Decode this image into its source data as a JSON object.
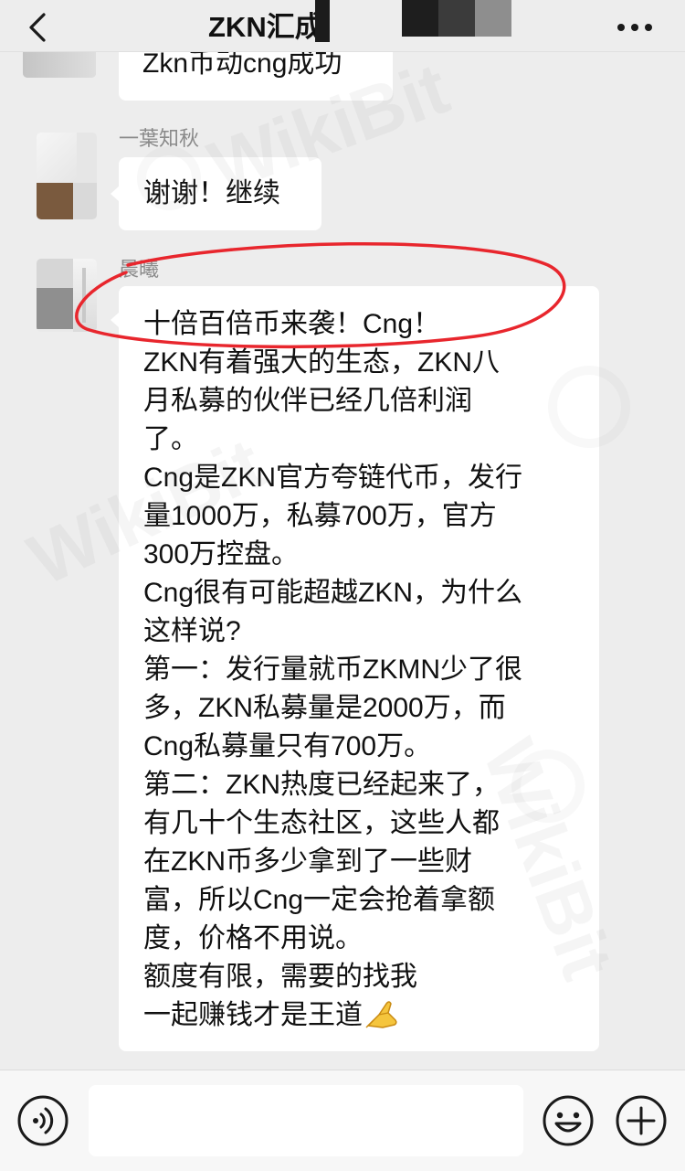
{
  "header": {
    "title": "ZKN汇成",
    "back_icon": "chevron-left-icon",
    "more_icon": "more-dots-icon"
  },
  "messages": [
    {
      "text": "Zkn币动cng成功"
    },
    {
      "sender": "一葉知秋",
      "text": "谢谢！继续"
    },
    {
      "sender": "晨曦",
      "lines": [
        "十倍百倍币来袭！Cng！",
        "ZKN有着强大的生态，ZKN八",
        "月私募的伙伴已经几倍利润",
        "了。",
        "Cng是ZKN官方夸链代币，发行",
        "量1000万，私募700万，官方",
        "300万控盘。",
        "Cng很有可能超越ZKN，为什么",
        "这样说?",
        "第一：发行量就币ZKMN少了很",
        "多，ZKN私募量是2000万，而",
        "Cng私募量只有700万。",
        "第二：ZKN热度已经起来了，",
        "有几十个生态社区，这些人都",
        "在ZKN币多少拿到了一些财",
        "富，所以Cng一定会抢着拿额",
        "度，价格不用说。",
        "额度有限，需要的找我",
        "一起赚钱才是王道"
      ],
      "trailing_icon": "praying-hands-icon"
    }
  ],
  "input_bar": {
    "voice_icon": "voice-icon",
    "emoji_icon": "smiley-icon",
    "plus_icon": "plus-icon"
  },
  "annotation": {
    "color": "#e8262d"
  },
  "watermark": "WikiBit",
  "colors": {
    "background": "#ededed",
    "bubble": "#ffffff",
    "sender_name": "#8a8a8a",
    "text": "#111111",
    "input_bar": "#f7f7f7"
  }
}
